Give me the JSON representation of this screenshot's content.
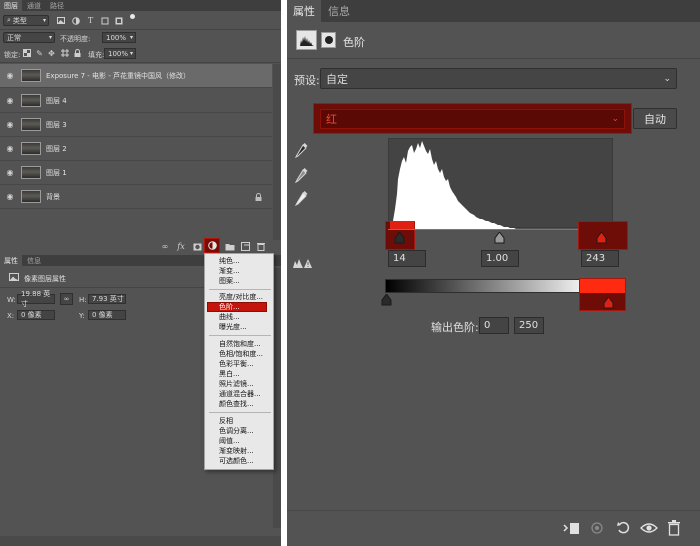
{
  "left": {
    "tabs": [
      "图层",
      "通道",
      "路径"
    ],
    "filter_kind": "类型",
    "blend_mode": "正常",
    "opacity_label": "不透明度:",
    "opacity_value": "100%",
    "lock_label": "锁定:",
    "fill_label": "填充:",
    "fill_value": "100%",
    "layers": [
      {
        "name": "Exposure 7 - 电影 - 芦花重镜中国风（修改）",
        "selected": true
      },
      {
        "name": "图层 4"
      },
      {
        "name": "图层 3"
      },
      {
        "name": "图层 2"
      },
      {
        "name": "图层 1"
      },
      {
        "name": "背景",
        "locked": true
      }
    ],
    "bottom_icons": {
      "fx": "fx"
    },
    "props": {
      "tabs": [
        "属性",
        "信息"
      ],
      "title": "像素图层属性",
      "w_label": "W:",
      "w_value": "19.88 英寸",
      "h_label": "H:",
      "h_value": "7.93 英寸",
      "x_label": "X:",
      "x_value": "0 像素",
      "y_label": "Y:",
      "y_value": "0 像素"
    },
    "menu_groups": [
      [
        "纯色...",
        "渐变...",
        "图案..."
      ],
      [
        "亮度/对比度...",
        "色阶...",
        "曲线...",
        "曝光度..."
      ],
      [
        "自然饱和度...",
        "色相/饱和度...",
        "色彩平衡...",
        "黑白...",
        "照片滤镜...",
        "通道混合器...",
        "颜色查找..."
      ],
      [
        "反相",
        "色调分离...",
        "阈值...",
        "渐变映射...",
        "可选颜色..."
      ]
    ],
    "menu_highlighted": "色阶..."
  },
  "right": {
    "tabs": [
      "属性",
      "信息"
    ],
    "title": "色阶",
    "preset_label": "预设:",
    "preset_value": "自定",
    "channel_value": "红",
    "auto_label": "自动",
    "input_black": "14",
    "input_gamma": "1.00",
    "input_white": "243",
    "output_label": "输出色阶:",
    "output_black": "0",
    "output_white": "250"
  },
  "colors": {
    "panel_bg": "#535353",
    "highlight_red": "#6e0d08",
    "menu_highlight": "#c4150c"
  }
}
